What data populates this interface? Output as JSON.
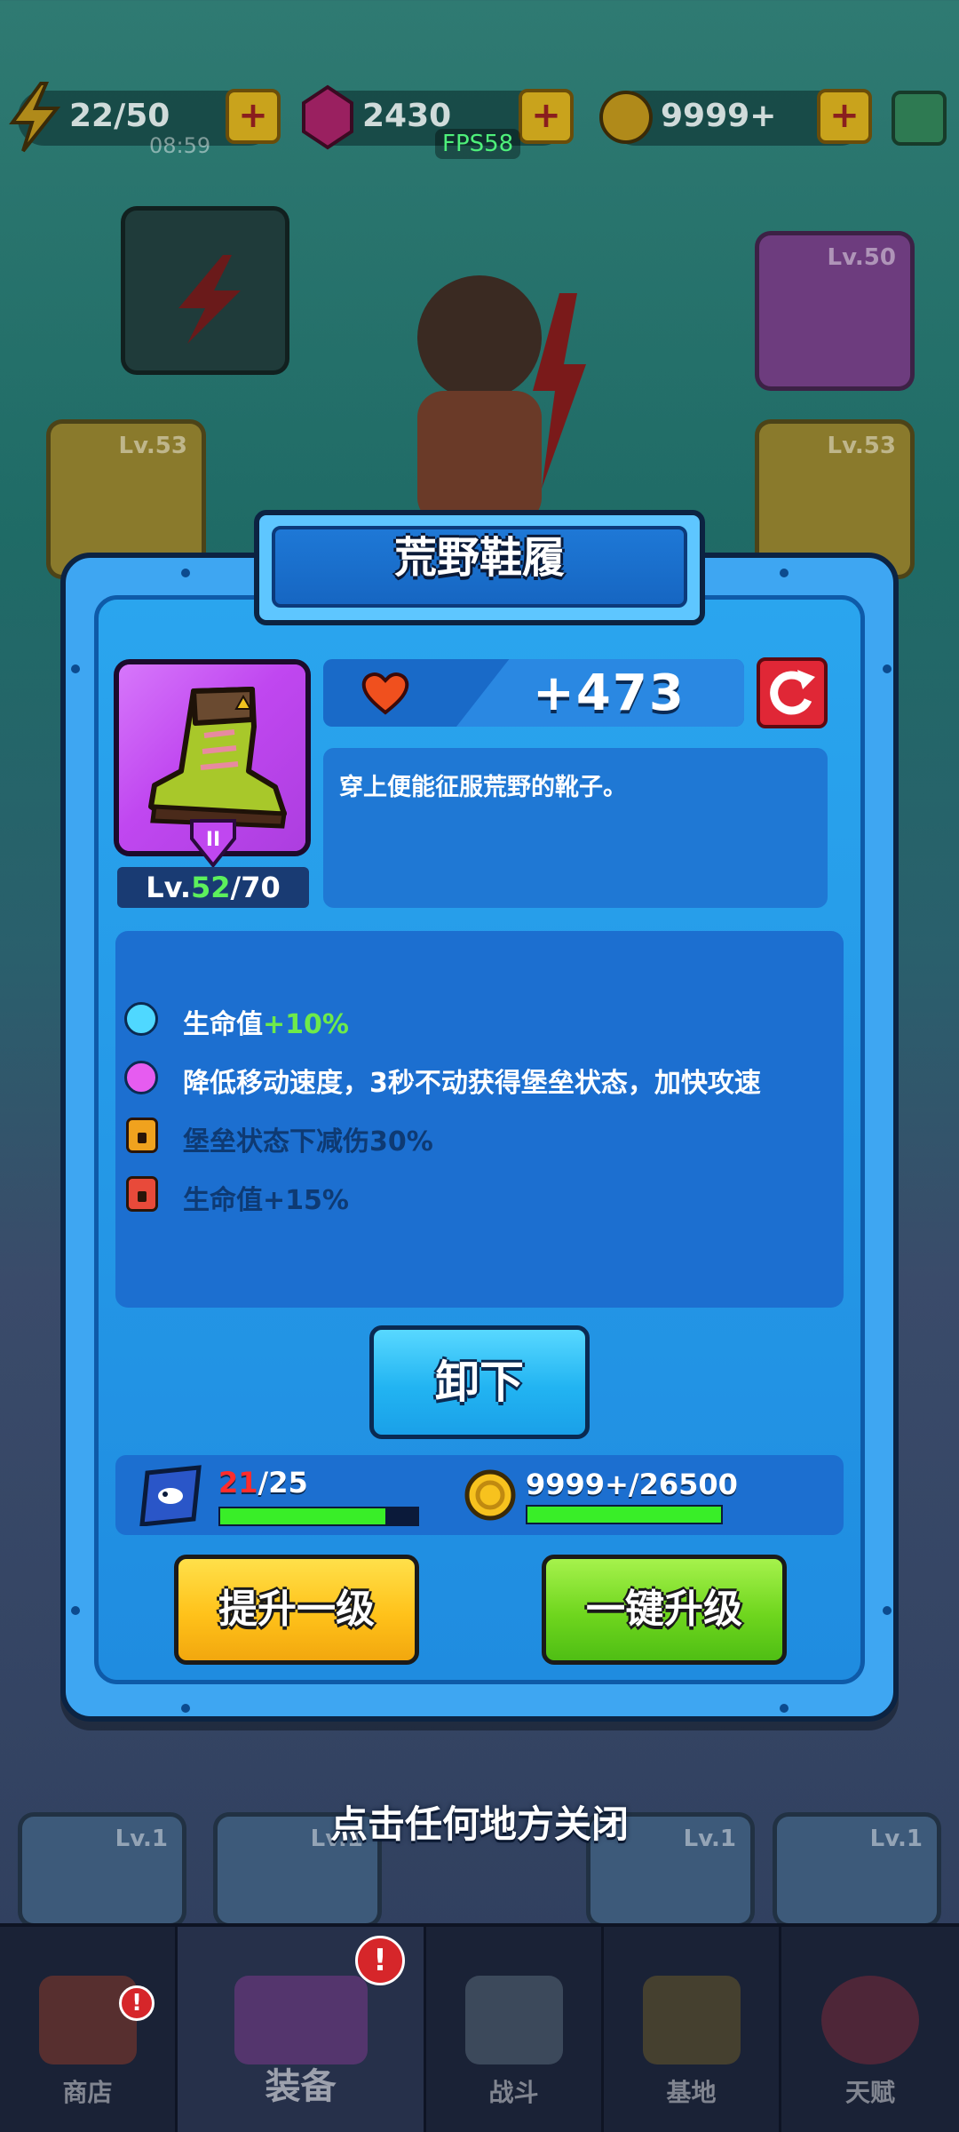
{
  "topbar": {
    "energy": "22/50",
    "energy_timer": "08:59",
    "gems": "2430",
    "gold": "9999+",
    "fps": "FPS58",
    "plus": "+"
  },
  "background_slots": [
    {
      "level": "Lv.50",
      "rarity": "purple"
    },
    {
      "level": "Lv.53",
      "rarity": "gold"
    },
    {
      "level": "Lv.53",
      "rarity": "gold"
    },
    {
      "level": "Lv.1",
      "rarity": "blue"
    },
    {
      "level": "Lv.1",
      "rarity": "blue"
    },
    {
      "level": "Lv.1",
      "rarity": "blue"
    },
    {
      "level": "Lv.1",
      "rarity": "blue"
    }
  ],
  "modal": {
    "title": "荒野鞋履",
    "item_level_current": "52",
    "item_level_max": "/70",
    "item_level_prefix": "Lv.",
    "grade": "II",
    "stat_value": "+473",
    "stat_icon": "heart-icon",
    "description": "穿上便能征服荒野的靴子。",
    "attributes": [
      {
        "label": "生命值",
        "bonus": "+10%",
        "state": "active",
        "color": "#4fd8ff"
      },
      {
        "label": "降低移动速度，3秒不动获得堡垒状态，加快攻速",
        "bonus": "",
        "state": "active",
        "color": "#e65cf0"
      },
      {
        "label": "堡垒状态下减伤30%",
        "bonus": "",
        "state": "locked",
        "color": "#f0a21e"
      },
      {
        "label": "生命值+15%",
        "bonus": "",
        "state": "locked",
        "color": "#e84a3a"
      }
    ],
    "unequip_label": "卸下",
    "scroll_have": "21",
    "scroll_need": "/25",
    "scroll_progress": 0.84,
    "gold_text": "9999+/26500",
    "gold_progress": 1.0,
    "upgrade_one_label": "提升一级",
    "upgrade_max_label": "一键升级"
  },
  "close_hint": "点击任何地方关闭",
  "bottom_nav": [
    {
      "label": "商店",
      "alert": "!"
    },
    {
      "label": "装备",
      "alert": "!"
    },
    {
      "label": "战斗",
      "alert": ""
    },
    {
      "label": "基地",
      "alert": ""
    },
    {
      "label": "天赋",
      "alert": ""
    }
  ],
  "colors": {
    "accent_blue": "#2aa5ee",
    "level_green": "#5cf05c",
    "bonus_green": "#6eea4a",
    "warning_red": "#ff2c2c",
    "progress_green": "#39ee28"
  }
}
